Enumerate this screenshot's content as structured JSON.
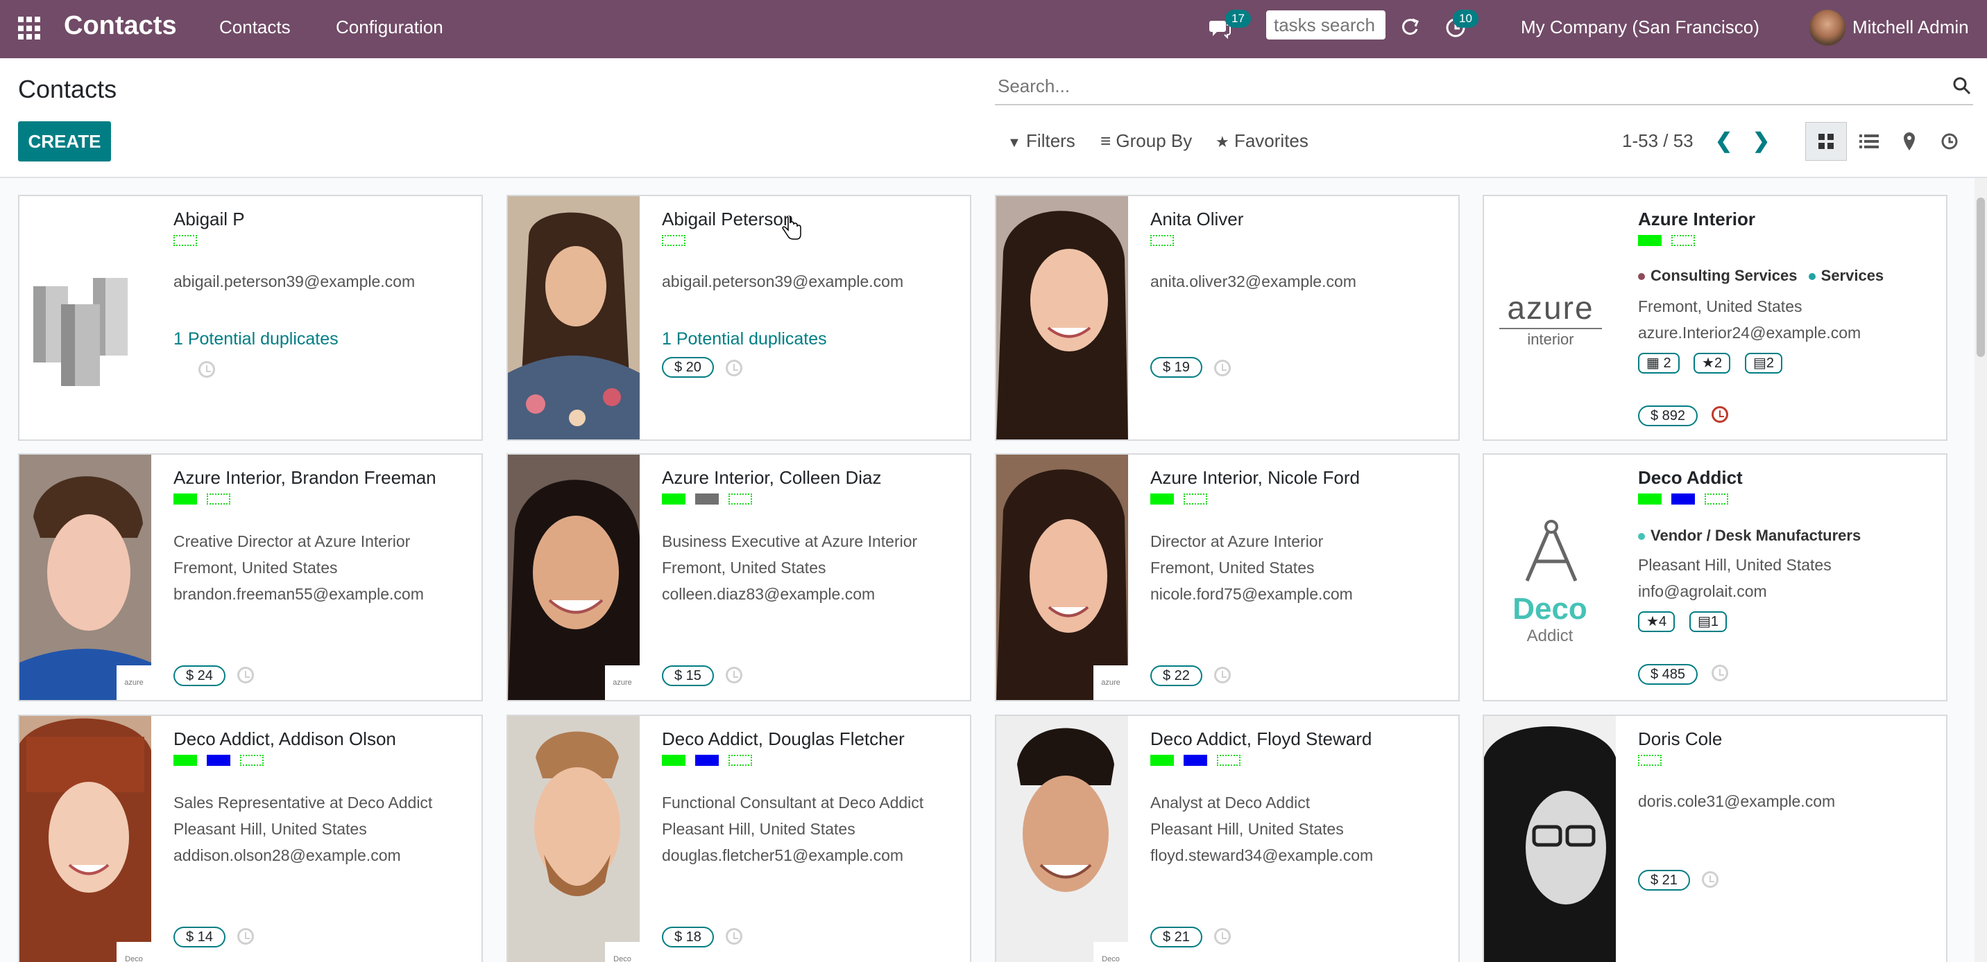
{
  "navbar": {
    "brand": "Contacts",
    "menu": [
      "Contacts",
      "Configuration"
    ],
    "chat_count": "17",
    "tasks_search_placeholder": "tasks search",
    "activity_count": "10",
    "company": "My Company (San Francisco)",
    "user": "Mitchell Admin",
    "bg_color": "#714b67"
  },
  "control_panel": {
    "title": "Contacts",
    "create_label": "CREATE",
    "search_placeholder": "Search...",
    "filters_label": "Filters",
    "groupby_label": "Group By",
    "favorites_label": "Favorites",
    "pager": "1-53 / 53",
    "active_view": "kanban"
  },
  "cards": [
    {
      "name": "Abigail P",
      "email": "abigail.peterson39@example.com",
      "dup": "1 Potential duplicates",
      "photo": "company"
    },
    {
      "name": "Abigail Peterson",
      "email": "abigail.peterson39@example.com",
      "dup": "1 Potential duplicates",
      "money": "$ 20",
      "photo": "person"
    },
    {
      "name": "Anita Oliver",
      "email": "anita.oliver32@example.com",
      "money": "$ 19",
      "photo": "person"
    },
    {
      "name": "Azure Interior",
      "cat1": "Consulting Services",
      "cat2": "Services",
      "location": "Fremont, United States",
      "email": "azure.Interior24@example.com",
      "pill1": "2",
      "pill2": "2",
      "pill3": "2",
      "money": "$ 892",
      "logo": "azure",
      "logo_sub": "interior"
    },
    {
      "name": "Azure Interior, Brandon Freeman",
      "job": "Creative Director at Azure Interior",
      "location": "Fremont, United States",
      "email": "brandon.freeman55@example.com",
      "money": "$ 24",
      "mini": "azure"
    },
    {
      "name": "Azure Interior, Colleen Diaz",
      "job": "Business Executive at Azure Interior",
      "location": "Fremont, United States",
      "email": "colleen.diaz83@example.com",
      "money": "$ 15",
      "mini": "azure"
    },
    {
      "name": "Azure Interior, Nicole Ford",
      "job": "Director at Azure Interior",
      "location": "Fremont, United States",
      "email": "nicole.ford75@example.com",
      "money": "$ 22",
      "mini": "azure"
    },
    {
      "name": "Deco Addict",
      "cat1": "Vendor / Desk Manufacturers",
      "location": "Pleasant Hill, United States",
      "email": "info@agrolait.com",
      "pill1": "4",
      "pill2": "1",
      "money": "$ 485",
      "logo": "Deco",
      "logo_sub": "Addict"
    },
    {
      "name": "Deco Addict, Addison Olson",
      "job": "Sales Representative at Deco Addict",
      "location": "Pleasant Hill, United States",
      "email": "addison.olson28@example.com",
      "money": "$ 14",
      "mini": "Deco"
    },
    {
      "name": "Deco Addict, Douglas Fletcher",
      "job": "Functional Consultant at Deco Addict",
      "location": "Pleasant Hill, United States",
      "email": "douglas.fletcher51@example.com",
      "money": "$ 18",
      "mini": "Deco"
    },
    {
      "name": "Deco Addict, Floyd Steward",
      "job": "Analyst at Deco Addict",
      "location": "Pleasant Hill, United States",
      "email": "floyd.steward34@example.com",
      "money": "$ 21",
      "mini": "Deco"
    },
    {
      "name": "Doris Cole",
      "email": "doris.cole31@example.com",
      "money": "$ 21",
      "photo": "person"
    }
  ]
}
